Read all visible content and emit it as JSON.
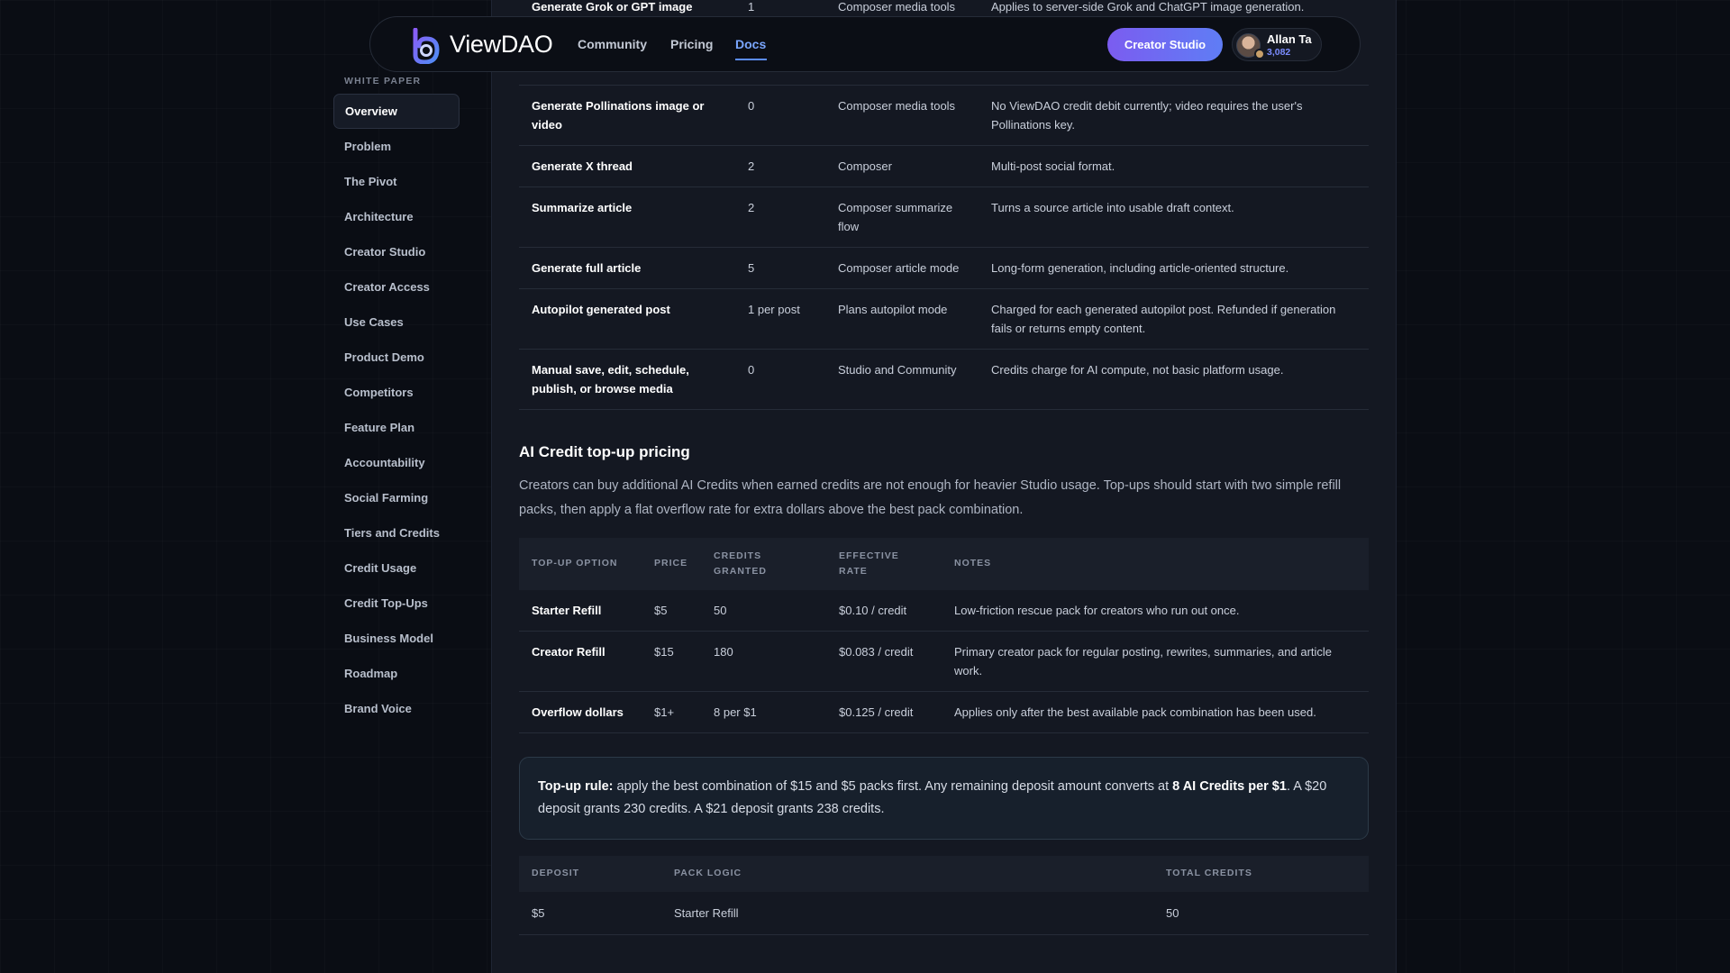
{
  "navbar": {
    "brand": "ViewDAO",
    "links": [
      "Community",
      "Pricing",
      "Docs"
    ],
    "active_link": "Docs",
    "cta": "Creator Studio",
    "user": {
      "name": "Allan Ta",
      "credits": "3,082"
    }
  },
  "sidebar": {
    "heading": "WHITE PAPER",
    "active": "Overview",
    "items": [
      "Overview",
      "Problem",
      "The Pivot",
      "Architecture",
      "Creator Studio",
      "Creator Access",
      "Use Cases",
      "Product Demo",
      "Competitors",
      "Feature Plan",
      "Accountability",
      "Social Farming",
      "Tiers and Credits",
      "Credit Usage",
      "Credit Top-Ups",
      "Business Model",
      "Roadmap",
      "Brand Voice"
    ]
  },
  "usage_table": {
    "rows": [
      {
        "operation": "Generate Grok or GPT image",
        "credits": "1",
        "where": "Composer media tools",
        "notes": "Applies to server-side Grok and ChatGPT image generation."
      },
      {
        "operation": "Generate Pollinations image or video",
        "credits": "0",
        "where": "Composer media tools",
        "notes": "No ViewDAO credit debit currently; video requires the user's Pollinations key."
      },
      {
        "operation": "Generate X thread",
        "credits": "2",
        "where": "Composer",
        "notes": "Multi-post social format."
      },
      {
        "operation": "Summarize article",
        "credits": "2",
        "where": "Composer summarize flow",
        "notes": "Turns a source article into usable draft context."
      },
      {
        "operation": "Generate full article",
        "credits": "5",
        "where": "Composer article mode",
        "notes": "Long-form generation, including article-oriented structure."
      },
      {
        "operation": "Autopilot generated post",
        "credits": "1 per post",
        "where": "Plans autopilot mode",
        "notes": "Charged for each generated autopilot post. Refunded if generation fails or returns empty content."
      },
      {
        "operation": "Manual save, edit, schedule, publish, or browse media",
        "credits": "0",
        "where": "Studio and Community",
        "notes": "Credits charge for AI compute, not basic platform usage."
      }
    ]
  },
  "topup_section": {
    "title": "AI Credit top-up pricing",
    "description": "Creators can buy additional AI Credits when earned credits are not enough for heavier Studio usage. Top-ups should start with two simple refill packs, then apply a flat overflow rate for extra dollars above the best pack combination."
  },
  "topup_table": {
    "headers": [
      "TOP-UP OPTION",
      "PRICE",
      "CREDITS GRANTED",
      "EFFECTIVE RATE",
      "NOTES"
    ],
    "rows": [
      {
        "option": "Starter Refill",
        "price": "$5",
        "credits": "50",
        "rate": "$0.10 / credit",
        "notes": "Low-friction rescue pack for creators who run out once."
      },
      {
        "option": "Creator Refill",
        "price": "$15",
        "credits": "180",
        "rate": "$0.083 / credit",
        "notes": "Primary creator pack for regular posting, rewrites, summaries, and article work."
      },
      {
        "option": "Overflow dollars",
        "price": "$1+",
        "credits": "8 per $1",
        "rate": "$0.125 / credit",
        "notes": "Applies only after the best available pack combination has been used."
      }
    ]
  },
  "callout": {
    "label": "Top-up rule:",
    "text_before": " apply the best combination of $15 and $5 packs first. Any remaining deposit amount converts at ",
    "highlight": "8 AI Credits per $1",
    "text_after": ". A $20 deposit grants 230 credits. A $21 deposit grants 238 credits."
  },
  "deposit_table": {
    "headers": [
      "DEPOSIT",
      "PACK LOGIC",
      "TOTAL CREDITS"
    ],
    "rows": [
      {
        "deposit": "$5",
        "logic": "Starter Refill",
        "total": "50"
      }
    ]
  },
  "colors": {
    "background": "#0a0d14",
    "panel": "#141822",
    "accent": "#5b8cff",
    "cta_gradient_start": "#7b5cf0",
    "cta_gradient_end": "#5f7df5"
  }
}
